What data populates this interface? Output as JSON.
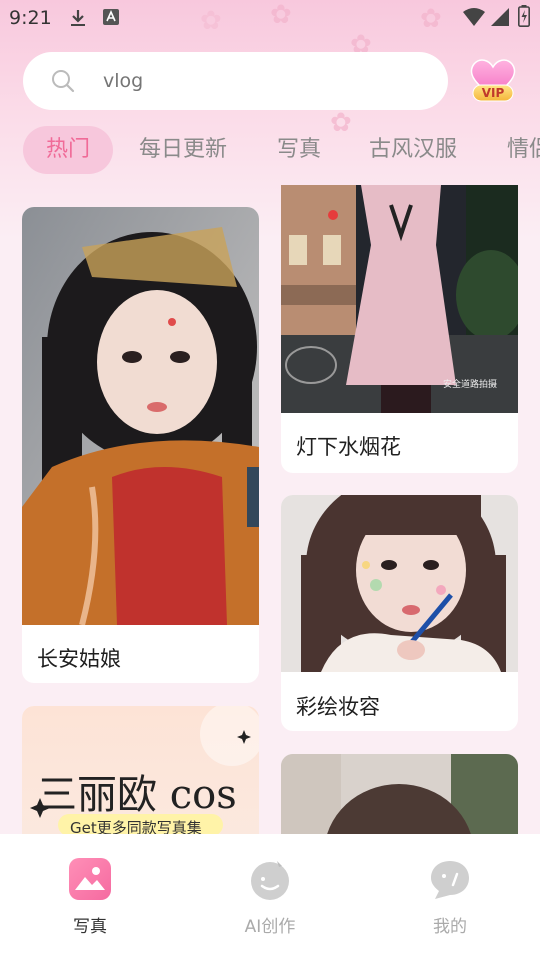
{
  "status_bar": {
    "time": "9:21",
    "icons": [
      "download-icon",
      "app-badge-icon",
      "wifi-icon",
      "signal-icon",
      "battery-icon"
    ]
  },
  "search": {
    "placeholder": "vlog",
    "icon": "search-icon"
  },
  "vip_badge": {
    "label": "VIP"
  },
  "tabs": [
    {
      "label": "热门",
      "active": true
    },
    {
      "label": "每日更新",
      "active": false
    },
    {
      "label": "写真",
      "active": false
    },
    {
      "label": "古风汉服",
      "active": false
    },
    {
      "label": "情侣",
      "active": false
    }
  ],
  "cards": [
    {
      "title": "长安姑娘"
    },
    {
      "title": "灯下水烟花"
    },
    {
      "title": "彩绘妆容"
    },
    {
      "title": "",
      "banner_main": "三丽欧 cos",
      "banner_sub": "Get更多同款写真集"
    },
    {
      "title": ""
    }
  ],
  "watermark": "安全道路拍摄",
  "bottom_nav": [
    {
      "label": "写真",
      "icon": "photo-icon",
      "active": true
    },
    {
      "label": "AI创作",
      "icon": "ai-face-icon",
      "active": false
    },
    {
      "label": "我的",
      "icon": "profile-chat-icon",
      "active": false
    }
  ],
  "colors": {
    "accent": "#f06b98",
    "active_tab_bg": "#f7c7dc",
    "background": "#fbeef4"
  }
}
